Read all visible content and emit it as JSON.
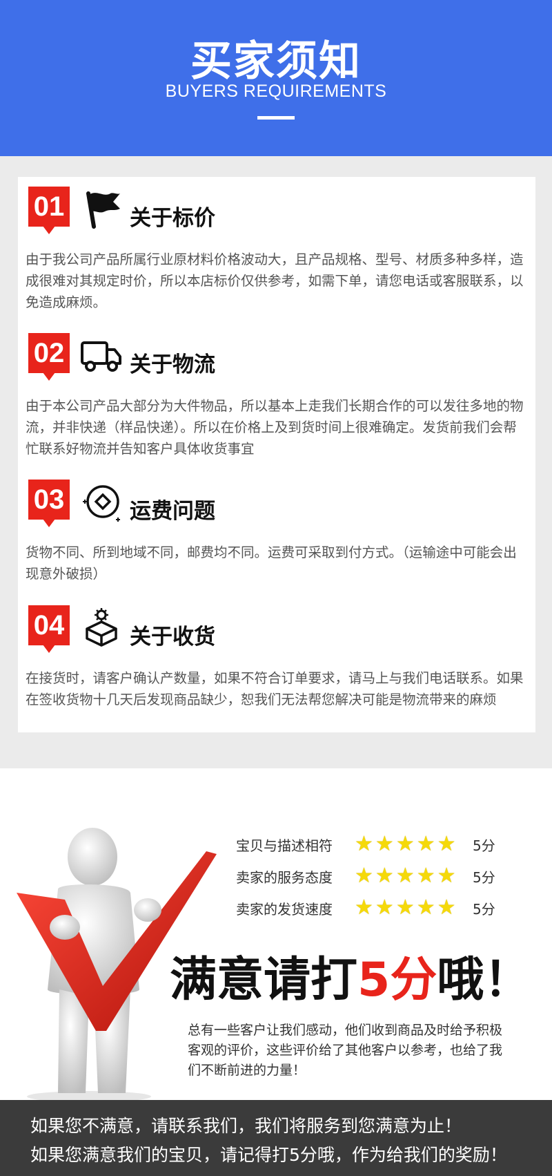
{
  "header": {
    "title": "买家须知",
    "subtitle": "BUYERS REQUIREMENTS"
  },
  "sections": [
    {
      "number": "01",
      "icon": "flag-icon",
      "title": "关于标价",
      "text": "由于我公司产品所属行业原材料价格波动大，且产品规格、型号、材质多种多样，造成很难对其规定时价，所以本店标价仅供参考，如需下单，请您电话或客服联系，以免造成麻烦。"
    },
    {
      "number": "02",
      "icon": "truck-icon",
      "title": "关于物流",
      "text": "由于本公司产品大部分为大件物品，所以基本上走我们长期合作的可以发往多地的物流，并非快递（样品快递）。所以在价格上及到货时间上很难确定。发货前我们会帮忙联系好物流并告知客户具体收货事宜"
    },
    {
      "number": "03",
      "icon": "coin-icon",
      "title": "运费问题",
      "text": "货物不同、所到地域不同，邮费均不同。运费可采取到付方式。（运输途中可能会出现意外破损）"
    },
    {
      "number": "04",
      "icon": "package-icon",
      "title": "关于收货",
      "text": "在接货时，请客户确认产数量，如果不符合订单要求，请马上与我们电话联系。如果在签收货物十几天后发现商品缺少，恕我们无法帮您解决可能是物流带来的麻烦"
    }
  ],
  "ratings": [
    {
      "label": "宝贝与描述相符",
      "stars": 5,
      "score": "5分"
    },
    {
      "label": "卖家的服务态度",
      "stars": 5,
      "score": "5分"
    },
    {
      "label": "卖家的发货速度",
      "stars": 5,
      "score": "5分"
    }
  ],
  "slogan": {
    "before": "满意请打",
    "highlight": "5分",
    "after": "哦！"
  },
  "note": "总有一些客户让我们感动，他们收到商品及时给予积极客观的评价，这些评价给了其他客户以参考，也给了我们不断前进的力量！",
  "footer": {
    "line1": "如果您不满意，请联系我们，我们将服务到您满意为止！",
    "line2": "如果您满意我们的宝贝，请记得打5分哦，作为给我们的奖励！"
  },
  "colors": {
    "header_bg": "#3f6fe9",
    "accent_red": "#e8241b",
    "star": "#f5d90a",
    "footer_bg": "#3b3b3b"
  }
}
